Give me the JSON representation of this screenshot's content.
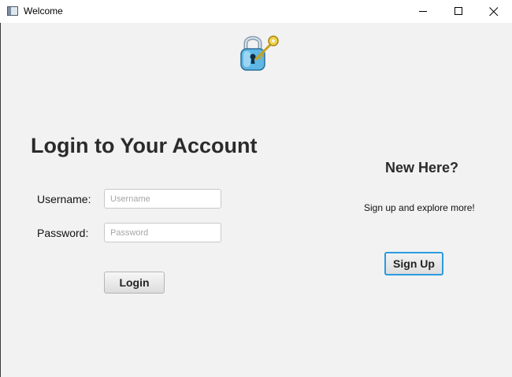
{
  "window": {
    "title": "Welcome",
    "icons": {
      "app": "window-app-icon",
      "minimize": "minimize-icon",
      "maximize": "maximize-icon",
      "close": "close-icon"
    }
  },
  "logo": {
    "icon": "padlock-with-key-icon"
  },
  "login": {
    "heading": "Login to Your Account",
    "username_label": "Username:",
    "username_placeholder": "Username",
    "password_label": "Password:",
    "password_placeholder": "Password",
    "login_button": "Login"
  },
  "signup": {
    "heading": "New Here?",
    "tagline": "Sign up and explore more!",
    "signup_button": "Sign Up",
    "accent_color": "#2b9be0"
  }
}
